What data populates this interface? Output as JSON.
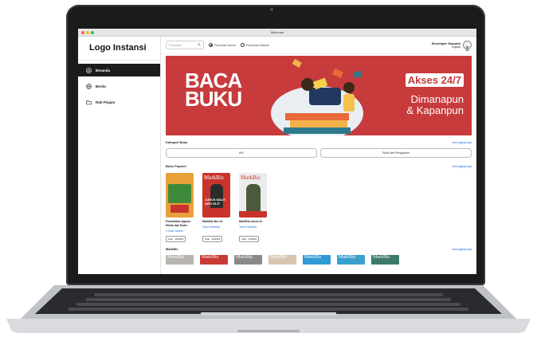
{
  "window": {
    "title": "Welcome"
  },
  "sidebar": {
    "logo": "Logo Instansi",
    "items": [
      {
        "label": "Beranda",
        "icon": "home-icon"
      },
      {
        "label": "Berita",
        "icon": "globe-icon"
      },
      {
        "label": "Rak Pinjam",
        "icon": "folder-icon"
      }
    ]
  },
  "topbar": {
    "search_placeholder": "Pencarian",
    "radio_options": [
      {
        "label": "Pencarian Umum",
        "selected": true
      },
      {
        "label": "Pencarian Katalok",
        "selected": false
      }
    ],
    "user_name": "Developer Sepuluh",
    "logout_label": "Logout"
  },
  "banner": {
    "left_text_1": "BACA",
    "left_text_2": "BUKU",
    "badge": "Akses 24/7",
    "tagline_1": "Dimanapun",
    "tagline_2": "& Kapanpun",
    "bg_color": "#c73b3d"
  },
  "categories": {
    "title": "Kategori Buku",
    "see_all": "selengkapnya",
    "items": [
      "IKK",
      "Studi dan Pengajaran"
    ]
  },
  "popular": {
    "title": "Buku Populer",
    "see_all": "selengkapnya",
    "books": [
      {
        "title": "Pendidikan Agama Hindu dan Budi...",
        "author": "I Gede Jamon",
        "stock": "Stok : 10/2024",
        "cover_color": "#e8a13a"
      },
      {
        "title": "MarkBiz Mei-13",
        "author": "Team MarkBiz",
        "stock": "Stok : 10/2024",
        "cover_color": "#c8342c"
      },
      {
        "title": "MarkBiz maret-13",
        "author": "Team MarkBiz",
        "stock": "Stok : 10/2024",
        "cover_color": "#ececec"
      }
    ]
  },
  "markbiz": {
    "title": "MarkBiz",
    "see_all": "selengkapnya",
    "items": [
      "MarkBiz",
      "MarkBiz",
      "MarkBiz",
      "MarkBiz",
      "MarkBiz",
      "MarkBiz",
      "MarkBiz"
    ],
    "colors": [
      "#b8b5b0",
      "#c83a34",
      "#8b8a88",
      "#d6c6b0",
      "#2f9ad4",
      "#3aa0d0",
      "#3b7a68"
    ]
  }
}
